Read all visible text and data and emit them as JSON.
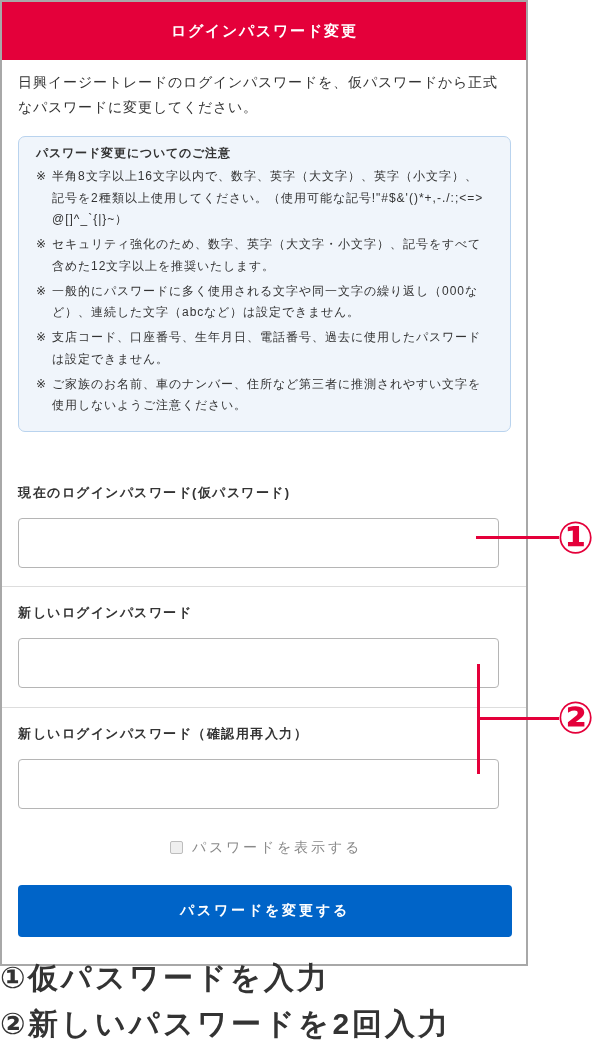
{
  "header": {
    "title": "ログインパスワード変更"
  },
  "intro": "日興イージートレードのログインパスワードを、仮パスワードから正式なパスワードに変更してください。",
  "notice": {
    "title": "パスワード変更についてのご注意",
    "items": [
      {
        "bullet": "※",
        "text": "半角8文字以上16文字以内で、数字、英字（大文字）、英字（小文字）、記号を2種類以上使用してください。（使用可能な記号!\"#$&'()*+,-./:;<=>@[]^_`{|}~）"
      },
      {
        "bullet": "※",
        "text": "セキュリティ強化のため、数字、英字（大文字・小文字）、記号をすべて含めた12文字以上を推奨いたします。"
      },
      {
        "bullet": "※",
        "text": "一般的にパスワードに多く使用される文字や同一文字の繰り返し（000など）、連続した文字（abcなど）は設定できません。"
      },
      {
        "bullet": "※",
        "text": "支店コード、口座番号、生年月日、電話番号、過去に使用したパスワードは設定できません。"
      },
      {
        "bullet": "※",
        "text": "ご家族のお名前、車のナンバー、住所など第三者に推測されやすい文字を使用しないようご注意ください。"
      }
    ]
  },
  "fields": [
    {
      "label": "現在のログインパスワード(仮パスワード)"
    },
    {
      "label": "新しいログインパスワード"
    },
    {
      "label": "新しいログインパスワード（確認用再入力）"
    }
  ],
  "show_password": {
    "label": "パスワードを表示する",
    "checked": false
  },
  "submit_button": {
    "label": "パスワードを変更する"
  },
  "callouts": [
    {
      "kind": "line",
      "number": "①"
    },
    {
      "kind": "bracket",
      "number": "②"
    }
  ],
  "captions": [
    "①仮パスワードを入力",
    "②新しいパスワードを2回入力"
  ]
}
